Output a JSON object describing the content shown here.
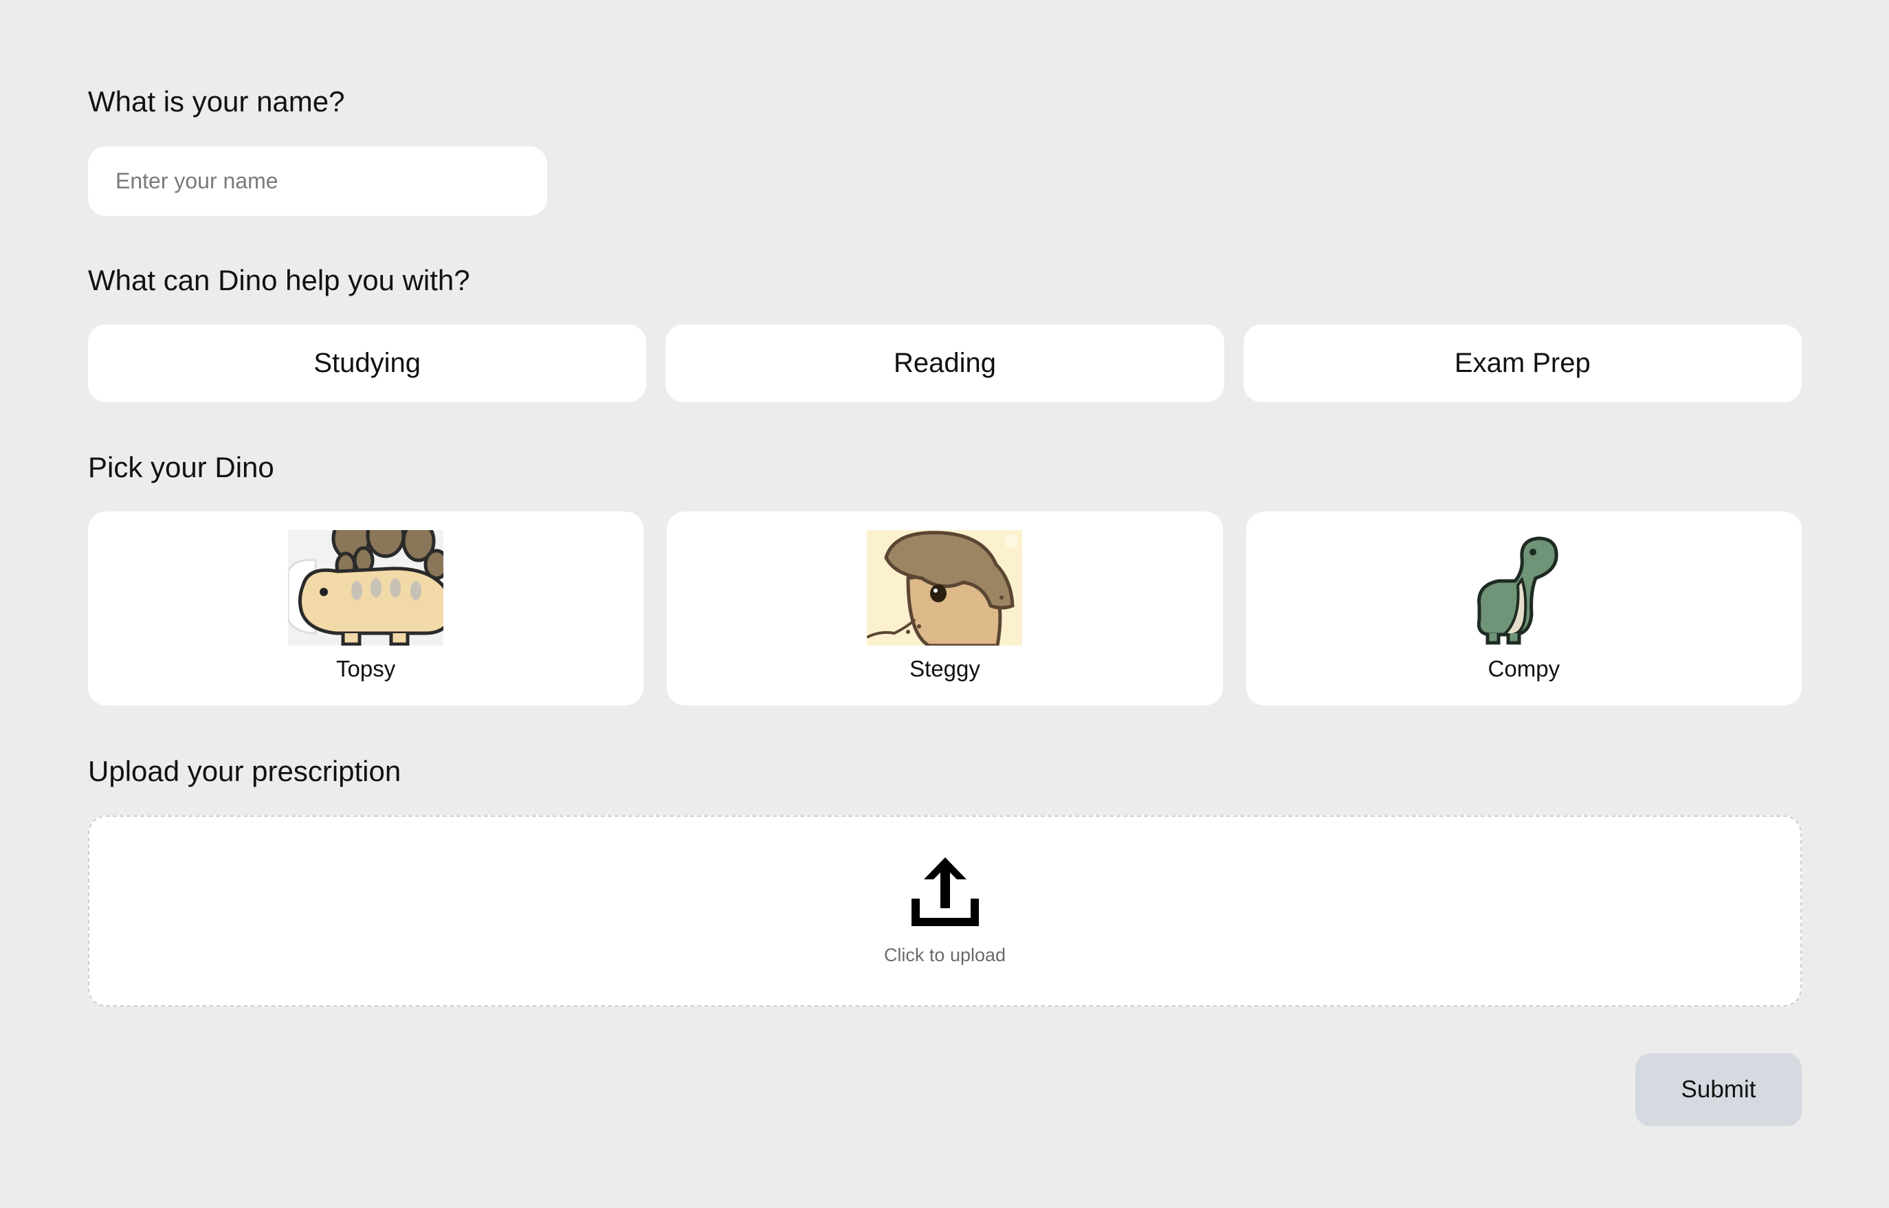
{
  "name_section": {
    "question": "What is your name?",
    "placeholder": "Enter your name",
    "value": ""
  },
  "help_section": {
    "question": "What can Dino help you with?",
    "options": [
      {
        "label": "Studying"
      },
      {
        "label": "Reading"
      },
      {
        "label": "Exam Prep"
      }
    ]
  },
  "dino_section": {
    "question": "Pick your Dino",
    "dinos": [
      {
        "name": "Topsy",
        "image": "topsy-illustration"
      },
      {
        "name": "Steggy",
        "image": "steggy-illustration"
      },
      {
        "name": "Compy",
        "image": "compy-illustration"
      }
    ]
  },
  "upload_section": {
    "question": "Upload your prescription",
    "icon": "upload-icon",
    "hint": "Click to upload"
  },
  "submit": {
    "label": "Submit"
  },
  "colors": {
    "background": "#ececec",
    "card": "#ffffff",
    "submit_button": "#d5d9e0",
    "hint_text": "#6b6b6b"
  }
}
